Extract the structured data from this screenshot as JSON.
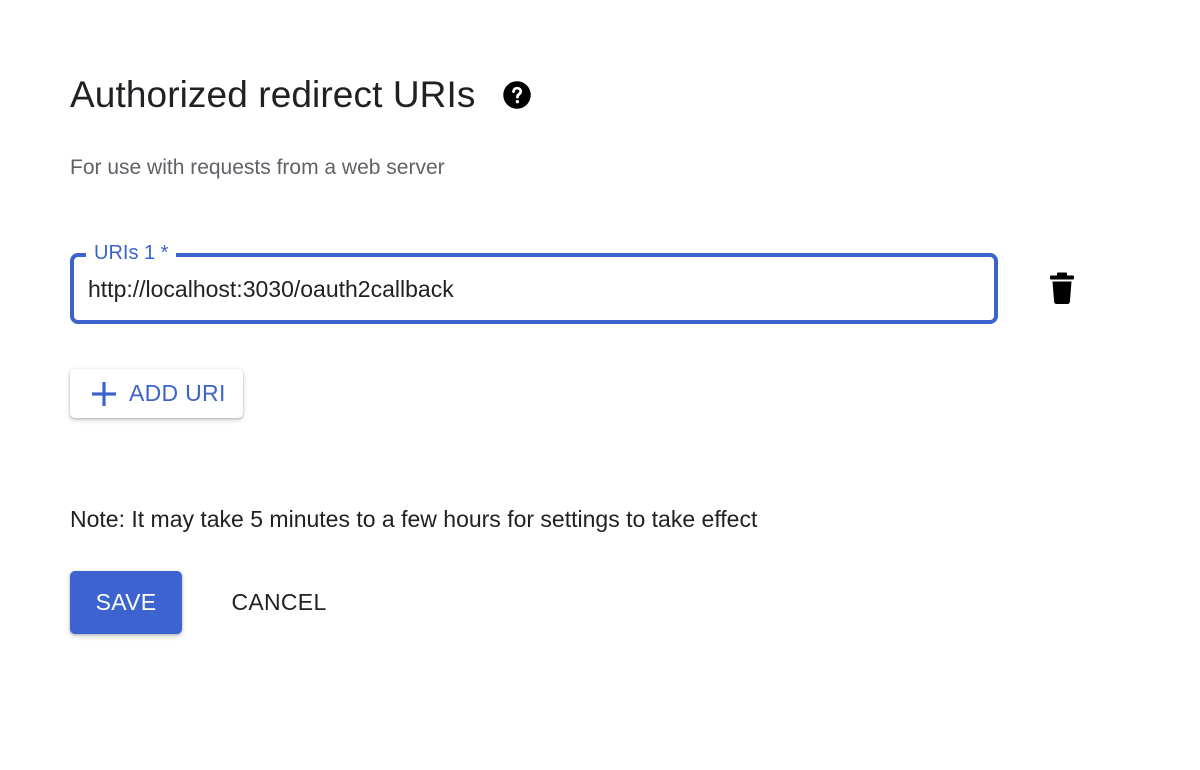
{
  "section": {
    "title": "Authorized redirect URIs",
    "help_icon": "help-circle-icon",
    "subtitle": "For use with requests from a web server"
  },
  "uri_field": {
    "label": "URIs 1 *",
    "value": "http://localhost:3030/oauth2callback",
    "delete_icon": "trash-icon"
  },
  "add_uri": {
    "icon": "plus-icon",
    "label": "ADD URI"
  },
  "note": "Note: It may take 5 minutes to a few hours for settings to take effect",
  "actions": {
    "save_label": "SAVE",
    "cancel_label": "CANCEL"
  },
  "colors": {
    "accent": "#3c63cc",
    "primary_button": "#3c63d0",
    "text": "#202124",
    "secondary_text": "#5f6368"
  }
}
